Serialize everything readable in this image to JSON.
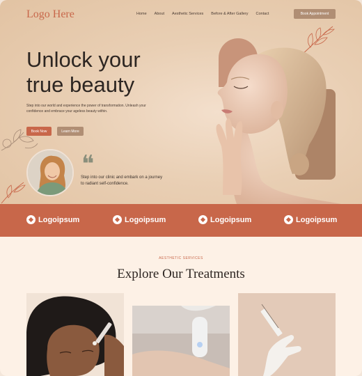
{
  "header": {
    "logo": "Logo Here",
    "nav": [
      "Home",
      "About",
      "Aesthetic Services",
      "Before & After Gallery",
      "Contact"
    ],
    "cta": "Book Appointment"
  },
  "hero": {
    "headline_line1": "Unlock your",
    "headline_line2": "true beauty",
    "subtext": "Step into our world and experience the power of transformation. Unleash your confidence and embrace your ageless beauty within.",
    "primary_button": "Book Now",
    "secondary_button": "Learn More",
    "quote_mark": "❝",
    "testimonial": "Step into our clinic and embark on a journey to radiant self-confidence."
  },
  "logo_strip": {
    "logos": [
      "Logoipsum",
      "Logoipsum",
      "Logoipsum",
      "Logoipsum"
    ]
  },
  "services": {
    "eyebrow": "AESTHETIC SERVICES",
    "title": "Explore Our Treatments"
  },
  "colors": {
    "accent": "#c8674a",
    "muted_brown": "#b08e74",
    "hero_bg": "#e9cfb4",
    "section_bg": "#fdf1e6"
  }
}
